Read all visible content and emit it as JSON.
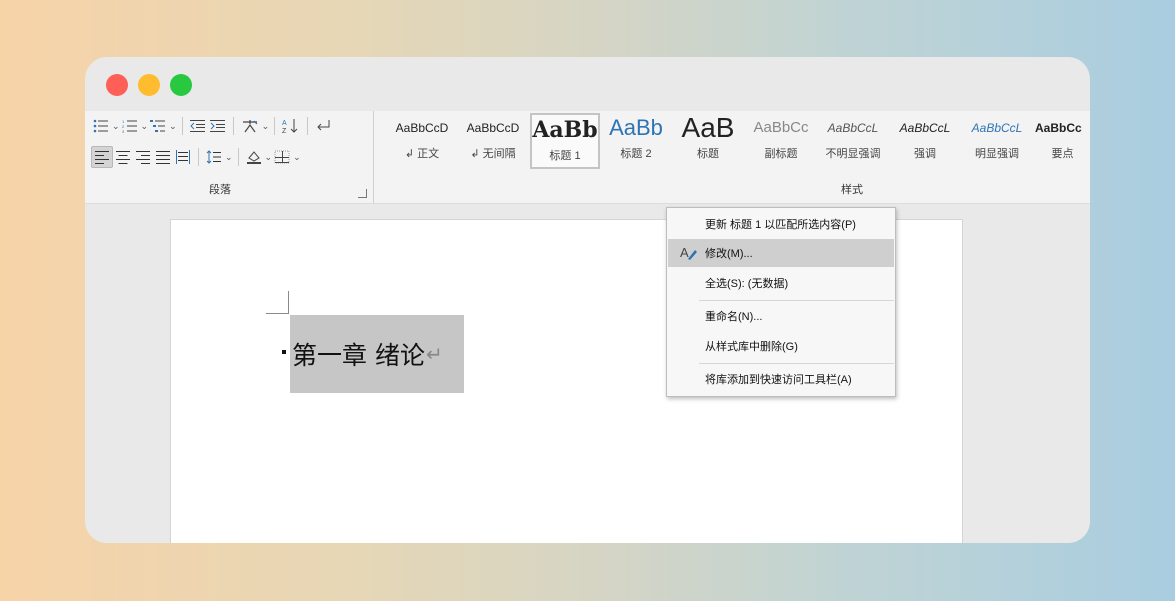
{
  "window": {
    "traffic_lights": [
      "close",
      "minimize",
      "zoom"
    ]
  },
  "ribbon": {
    "paragraph_group": {
      "label": "段落",
      "row1_icons": [
        "bullets-icon",
        "numbering-icon",
        "multilevel-list-icon",
        "decrease-indent-icon",
        "increase-indent-icon",
        "chinese-layout-icon",
        "sort-icon",
        "show-marks-icon"
      ],
      "row2_icons": [
        "align-left-icon",
        "align-center-icon",
        "align-right-icon",
        "justify-icon",
        "distributed-icon",
        "line-spacing-icon",
        "shading-icon",
        "borders-icon"
      ]
    },
    "styles_group": {
      "label": "样式",
      "tiles": [
        {
          "sample": "AaBbCcD",
          "name": "↲ 正文"
        },
        {
          "sample": "AaBbCcD",
          "name": "↲ 无间隔"
        },
        {
          "sample": "AaBb",
          "name": "标题 1"
        },
        {
          "sample": "AaBb",
          "name": "标题 2"
        },
        {
          "sample": "AaB",
          "name": "标题"
        },
        {
          "sample": "AaBbCc",
          "name": "副标题"
        },
        {
          "sample": "AaBbCcL",
          "name": "不明显强调"
        },
        {
          "sample": "AaBbCcL",
          "name": "强调"
        },
        {
          "sample": "AaBbCcL",
          "name": "明显强调"
        },
        {
          "sample": "AaBbCc",
          "name": "要点"
        }
      ]
    }
  },
  "document": {
    "heading": "第一章  绪论",
    "paragraph_mark": "↵"
  },
  "context_menu": {
    "items": [
      {
        "label": "更新 标题 1 以匹配所选内容(P)"
      },
      {
        "label": "修改(M)..."
      },
      {
        "label": "全选(S): (无数据)"
      },
      {
        "label": "重命名(N)..."
      },
      {
        "label": "从样式库中删除(G)"
      },
      {
        "label": "将库添加到快速访问工具栏(A)"
      }
    ],
    "hovered_index": 1
  },
  "colors": {
    "close": "#fe5f57",
    "minimize": "#febc2e",
    "zoom": "#28c840",
    "heading_blue": "#2e74b5",
    "selection": "#c6c6c6"
  }
}
